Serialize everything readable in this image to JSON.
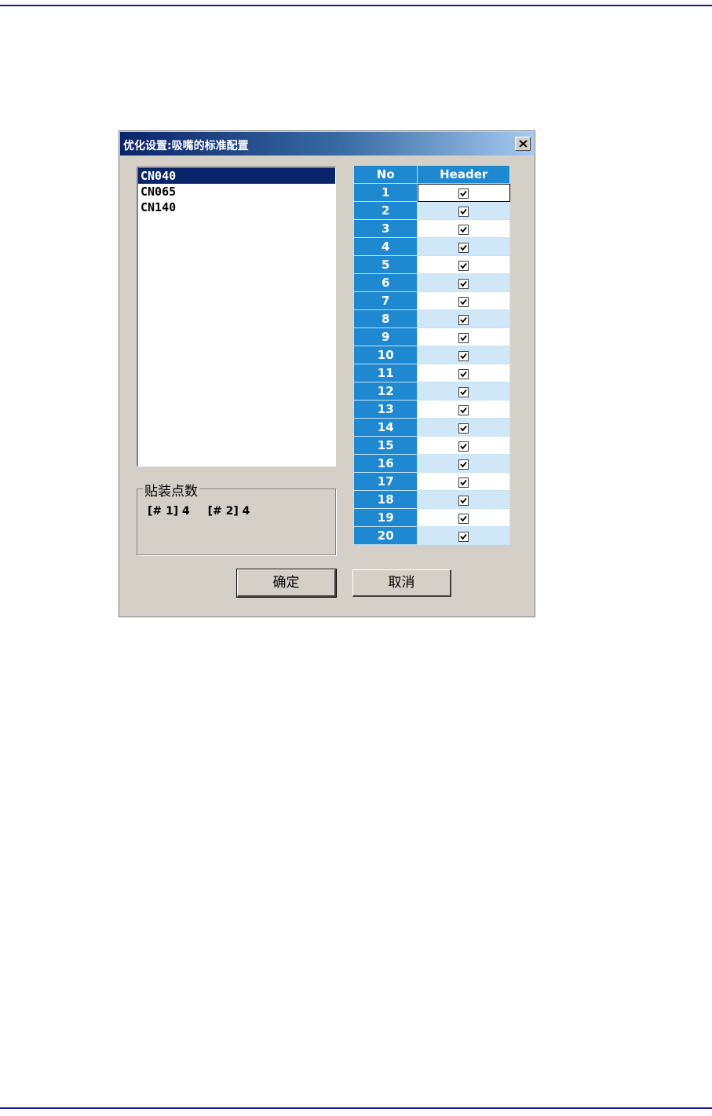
{
  "dialog": {
    "title": "优化设置:吸嘴的标准配置"
  },
  "nozzle_list": {
    "items": [
      "CN040",
      "CN065",
      "CN140"
    ],
    "selected": "CN040"
  },
  "placement_group": {
    "legend": "贴装点数",
    "counts": [
      "[# 1] 4",
      "[# 2] 4"
    ]
  },
  "grid": {
    "columns": [
      "No",
      "Header"
    ],
    "rows": [
      {
        "no": "1",
        "checked": true
      },
      {
        "no": "2",
        "checked": true
      },
      {
        "no": "3",
        "checked": true
      },
      {
        "no": "4",
        "checked": true
      },
      {
        "no": "5",
        "checked": true
      },
      {
        "no": "6",
        "checked": true
      },
      {
        "no": "7",
        "checked": true
      },
      {
        "no": "8",
        "checked": true
      },
      {
        "no": "9",
        "checked": true
      },
      {
        "no": "10",
        "checked": true
      },
      {
        "no": "11",
        "checked": true
      },
      {
        "no": "12",
        "checked": true
      },
      {
        "no": "13",
        "checked": true
      },
      {
        "no": "14",
        "checked": true
      },
      {
        "no": "15",
        "checked": true
      },
      {
        "no": "16",
        "checked": true
      },
      {
        "no": "17",
        "checked": true
      },
      {
        "no": "18",
        "checked": true
      },
      {
        "no": "19",
        "checked": true
      },
      {
        "no": "20",
        "checked": true
      }
    ]
  },
  "buttons": {
    "ok": "确定",
    "cancel": "取消"
  },
  "icons": {
    "close": "close-icon",
    "checkbox": "checkmark-icon"
  },
  "colors": {
    "title_gradient_start": "#0a246a",
    "grid_header": "#1e88d0",
    "grid_alt_row": "#cfe7f6",
    "dialog_face": "#d4d0c8"
  }
}
